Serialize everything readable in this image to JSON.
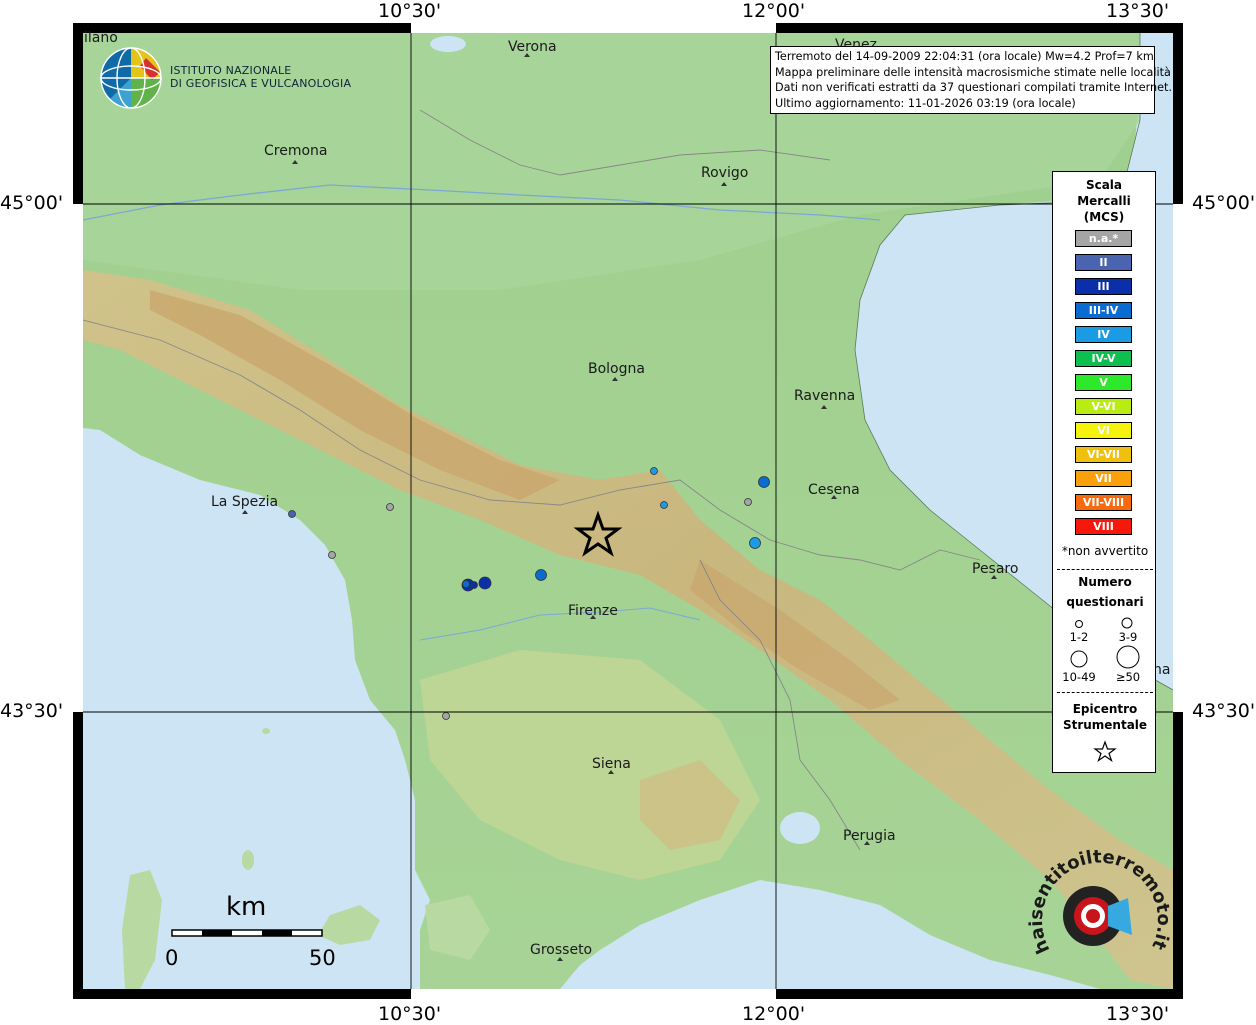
{
  "map": {
    "lon_labels": [
      "10°30'",
      "12°00'",
      "13°30'"
    ],
    "lat_labels": [
      "45°00'",
      "43°30'"
    ],
    "cities": [
      {
        "name": "Verona"
      },
      {
        "name": "Cremona"
      },
      {
        "name": "Rovigo"
      },
      {
        "name": "Bologna"
      },
      {
        "name": "Ravenna"
      },
      {
        "name": "Cesena"
      },
      {
        "name": "La Spezia"
      },
      {
        "name": "Pesaro"
      },
      {
        "name": "Firenze"
      },
      {
        "name": "Siena"
      },
      {
        "name": "Perugia"
      },
      {
        "name": "Grosseto"
      }
    ],
    "edge_fragments": [
      "ilano",
      "Venez",
      "na"
    ],
    "scalebar": {
      "unit": "km",
      "start": "0",
      "end": "50"
    }
  },
  "info": {
    "line1": "Terremoto del 14-09-2009 22:04:31 (ora locale) Mw=4.2 Prof=7 km",
    "line2": "Mappa preliminare delle intensità macrosismiche stimate nelle località",
    "line3": "Dati non verificati estratti da 37 questionari compilati tramite Internet.",
    "line4": "Ultimo aggiornamento: 11-01-2026 03:19 (ora locale)"
  },
  "logo": {
    "line1": "ISTITUTO NAZIONALE",
    "line2": "DI GEOFISICA E VULCANOLOGIA"
  },
  "badge": {
    "text": "haisentitoilterremoto.it  www."
  },
  "legend": {
    "title": [
      "Scala",
      "Mercalli",
      "(MCS)"
    ],
    "classes": [
      {
        "label": "n.a.*",
        "color": "#a5a5a5"
      },
      {
        "label": "II",
        "color": "#4a64b0"
      },
      {
        "label": "III",
        "color": "#0b2fa8"
      },
      {
        "label": "III-IV",
        "color": "#0a6bd0"
      },
      {
        "label": "IV",
        "color": "#1b9be3"
      },
      {
        "label": "IV-V",
        "color": "#0dbf4f"
      },
      {
        "label": "V",
        "color": "#2ee82a"
      },
      {
        "label": "V-VI",
        "color": "#b8ec12"
      },
      {
        "label": "VI",
        "color": "#f5f20c"
      },
      {
        "label": "VI-VII",
        "color": "#f0c10c"
      },
      {
        "label": "VII",
        "color": "#f9a00b"
      },
      {
        "label": "VII-VIII",
        "color": "#f86a0d"
      },
      {
        "label": "VIII",
        "color": "#f8170b"
      }
    ],
    "na_note": "*non avvertito",
    "count_title": [
      "Numero",
      "questionari"
    ],
    "count_classes": [
      "1-2",
      "3-9",
      "10-49",
      "≥50"
    ],
    "epicentre_title": [
      "Epicentro",
      "Strumentale"
    ]
  },
  "observations": [
    {
      "intensity": "III",
      "count_class": "10-49"
    },
    {
      "intensity": "III",
      "count_class": "10-49"
    },
    {
      "intensity": "III-IV",
      "count_class": "3-9"
    },
    {
      "intensity": "IV",
      "count_class": "1-2"
    },
    {
      "intensity": "IV",
      "count_class": "1-2"
    },
    {
      "intensity": "IV",
      "count_class": "3-9"
    },
    {
      "intensity": "III-IV",
      "count_class": "3-9"
    },
    {
      "intensity": "II",
      "count_class": "1-2"
    },
    {
      "intensity": "n.a.*",
      "count_class": "1-2"
    },
    {
      "intensity": "n.a.*",
      "count_class": "1-2"
    },
    {
      "intensity": "n.a.*",
      "count_class": "1-2"
    },
    {
      "intensity": "n.a.*",
      "count_class": "1-2"
    },
    {
      "intensity": "III",
      "count_class": "1-2"
    },
    {
      "intensity": "III-IV",
      "count_class": "1-2"
    }
  ]
}
